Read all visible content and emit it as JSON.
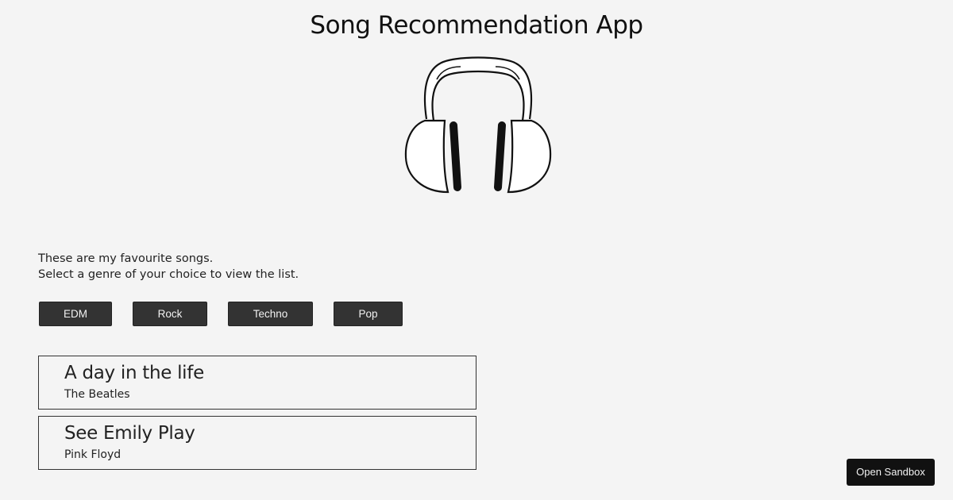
{
  "app": {
    "title": "Song Recommendation App"
  },
  "intro": {
    "line1": "These are my favourite songs.",
    "line2": "Select a genre of your choice to view the list."
  },
  "genres": [
    "EDM",
    "Rock",
    "Techno",
    "Pop"
  ],
  "songs": [
    {
      "title": "A day in the life",
      "artist": "The Beatles"
    },
    {
      "title": "See Emily Play",
      "artist": "Pink Floyd"
    }
  ],
  "sandbox": {
    "label": "Open Sandbox"
  },
  "icons": {
    "logo": "headphones-icon"
  },
  "colors": {
    "background": "#f4f4f4",
    "button": "#333333",
    "sandbox_button": "#111111"
  }
}
